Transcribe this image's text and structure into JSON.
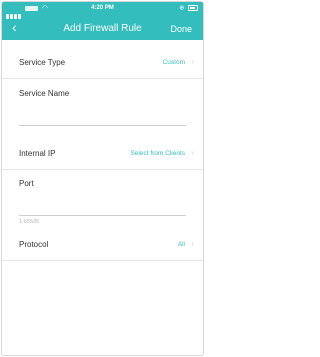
{
  "status_bar": {
    "wifi_icon": "wifi-icon",
    "time": "4:20 PM",
    "right_indicators": "⊕"
  },
  "nav": {
    "back_icon": "‹",
    "title": "Add Firewall Rule",
    "done_label": "Done"
  },
  "form": {
    "service_type": {
      "label": "Service Type",
      "value": "Custom",
      "chevron": "›"
    },
    "service_name": {
      "label": "Service Name",
      "value": ""
    },
    "internal_ip": {
      "label": "Internal IP",
      "value": "Select from Clients",
      "chevron": "›"
    },
    "port": {
      "label": "Port",
      "value": "",
      "hint": "1-65535"
    },
    "protocol": {
      "label": "Protocol",
      "value": "All",
      "chevron": "›"
    }
  },
  "colors": {
    "accent": "#33bdbd",
    "text": "#333333",
    "divider": "#e7e7e7"
  }
}
